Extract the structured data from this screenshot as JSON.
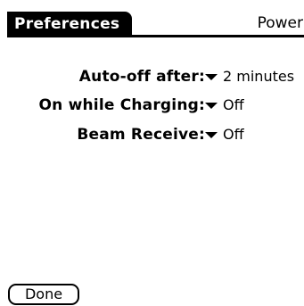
{
  "title": "Preferences",
  "category": "Power",
  "settings": [
    {
      "label": "Auto-off after:",
      "value": "2 minutes"
    },
    {
      "label": "On while Charging:",
      "value": "Off"
    },
    {
      "label": "Beam Receive:",
      "value": "Off"
    }
  ],
  "done_label": "Done"
}
